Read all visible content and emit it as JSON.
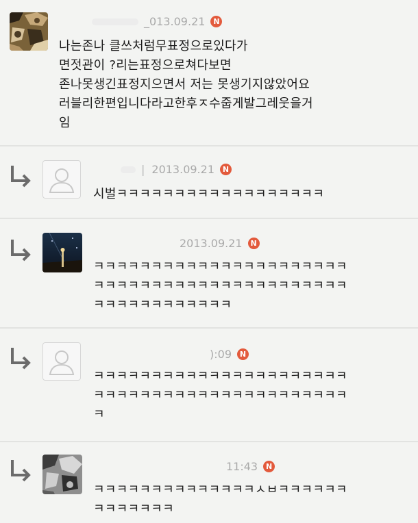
{
  "comments": [
    {
      "date": "_013.09.21",
      "bar": "",
      "lines": [
        "나는존나 클쓰처럼무표정으로있다가",
        "면젓관이 ?리는표정으로쳐다보면",
        "존나못생긴표정지으면서 저는 못생기지않았어요",
        "러블리한편입니다라고한후ㅈ수줍게발그레웃을거",
        "임"
      ],
      "badge": "N"
    },
    {
      "date": "2013.09.21",
      "bar": "|",
      "lines": [
        "시벌ㅋㅋㅋㅋㅋㅋㅋㅋㅋㅋㅋㅋㅋㅋㅋㅋㅋㅋ"
      ],
      "badge": "N"
    },
    {
      "date": "2013.09.21",
      "bar": "",
      "lines": [
        "ㅋㅋㅋㅋㅋㅋㅋㅋㅋㅋㅋㅋㅋㅋㅋㅋㅋㅋㅋㅋㅋㅋ",
        "ㅋㅋㅋㅋㅋㅋㅋㅋㅋㅋㅋㅋㅋㅋㅋㅋㅋㅋㅋㅋㅋㅋ",
        "ㅋㅋㅋㅋㅋㅋㅋㅋㅋㅋㅋㅋ"
      ],
      "badge": "N"
    },
    {
      "date": "):09",
      "bar": "",
      "lines": [
        "ㅋㅋㅋㅋㅋㅋㅋㅋㅋㅋㅋㅋㅋㅋㅋㅋㅋㅋㅋㅋㅋㅋ",
        "ㅋㅋㅋㅋㅋㅋㅋㅋㅋㅋㅋㅋㅋㅋㅋㅋㅋㅋㅋㅋㅋㅋ",
        "ㅋ"
      ],
      "badge": "N"
    },
    {
      "date": "11:43",
      "bar": "",
      "lines": [
        "ㅋㅋㅋㅋㅋㅋㅋㅋㅋㅋㅋㅋㅋㅋㅅㅂㅋㅋㅋㅋㅋㅋ",
        "ㅋㅋㅋㅋㅋㅋㅋ"
      ],
      "badge": "N"
    }
  ],
  "icons": {
    "reply_arrow": "reply-arrow-icon",
    "default_avatar": "default-user-icon",
    "new_badge": "new-badge-icon"
  },
  "colors": {
    "background": "#f3f4f2",
    "badge": "#e35a3c",
    "meta_text": "#a9a9a9",
    "divider": "#e2e3e1"
  }
}
